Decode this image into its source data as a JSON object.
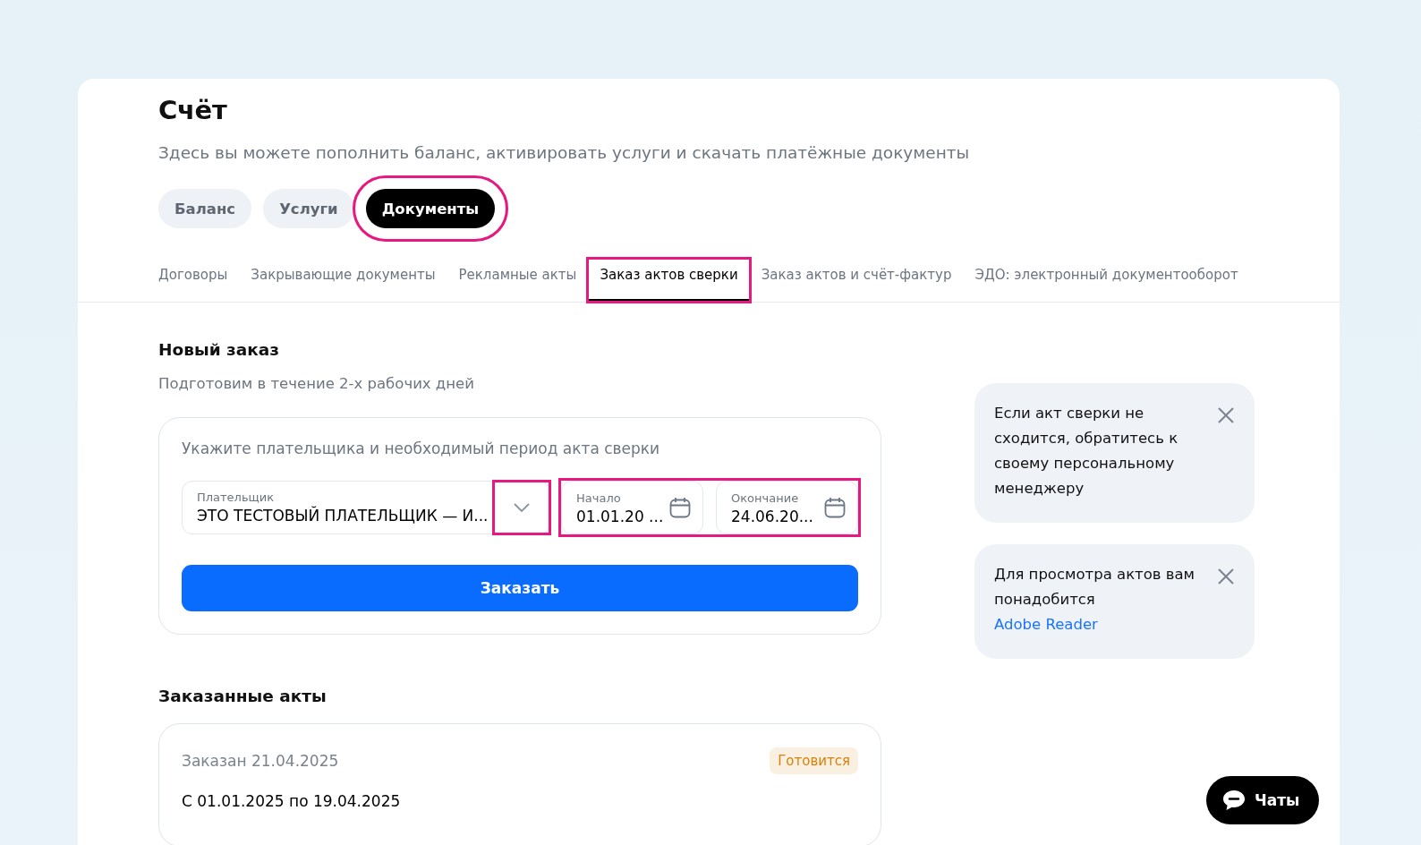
{
  "page": {
    "title": "Счёт",
    "subtitle": "Здесь вы можете пополнить баланс, активировать услуги и скачать платёжные документы"
  },
  "main_tabs": [
    {
      "label": "Баланс",
      "selected": false,
      "highlighted": false
    },
    {
      "label": "Услуги",
      "selected": false,
      "highlighted": false
    },
    {
      "label": "Документы",
      "selected": true,
      "highlighted": true
    }
  ],
  "sub_tabs": [
    {
      "label": "Договоры",
      "selected": false,
      "highlighted": false
    },
    {
      "label": "Закрывающие документы",
      "selected": false,
      "highlighted": false
    },
    {
      "label": "Рекламные акты",
      "selected": false,
      "highlighted": false
    },
    {
      "label": "Заказ актов сверки",
      "selected": true,
      "highlighted": true
    },
    {
      "label": "Заказ актов и счёт-фактур",
      "selected": false,
      "highlighted": false
    },
    {
      "label": "ЭДО: электронный документооборот",
      "selected": false,
      "highlighted": false
    }
  ],
  "new_order": {
    "title": "Новый заказ",
    "subtitle": "Подготовим в течение 2-х рабочих дней",
    "form": {
      "instruction": "Укажите плательщика и необходимый период акта сверки",
      "payer": {
        "label": "Плательщик",
        "value": "ЭТО ТЕСТОВЫЙ ПЛАТЕЛЬЩИК — И...",
        "chevron_highlighted": true
      },
      "dates_highlighted": true,
      "start": {
        "label": "Начало",
        "value": "01.01.20 ..."
      },
      "end": {
        "label": "Окончание",
        "value": "24.06.20..."
      },
      "submit": "Заказать"
    }
  },
  "info_cards": [
    {
      "text": "Если акт сверки не сходится, обратитесь к своему персональному менеджеру"
    },
    {
      "text": "Для просмотра актов вам понадобится",
      "link": "Adobe Reader"
    }
  ],
  "ordered": {
    "title": "Заказанные акты",
    "items": [
      {
        "date": "Заказан 21.04.2025",
        "status": "Готовится",
        "color": "#d9800b",
        "period": "С 01.01.2025 по 19.04.2025"
      }
    ]
  },
  "chat_button": "Чаты"
}
